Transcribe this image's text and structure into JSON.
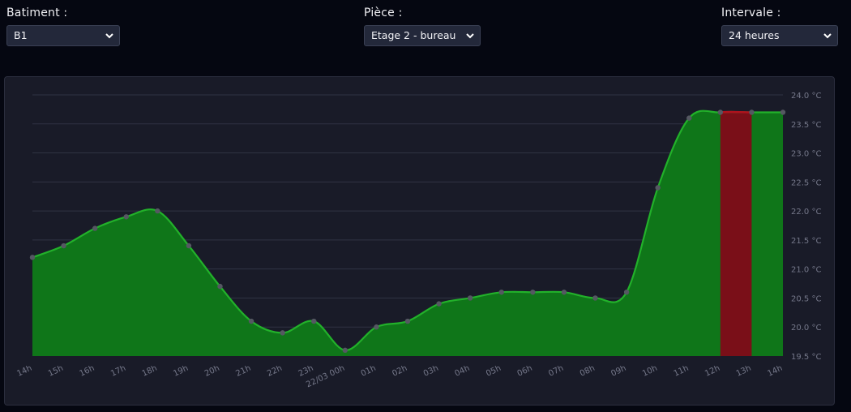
{
  "filters": {
    "batiment": {
      "label": "Batiment :",
      "value": "B1"
    },
    "piece": {
      "label": "Pièce :",
      "value": "Etage 2 - bureau"
    },
    "intervale": {
      "label": "Intervale :",
      "value": "24 heures"
    }
  },
  "chart_data": {
    "type": "area",
    "title": "",
    "xlabel": "",
    "ylabel": "",
    "ylim": [
      19.5,
      24.0
    ],
    "y_ticks": [
      "19.5 °C",
      "20.0 °C",
      "20.5 °C",
      "21.0 °C",
      "21.5 °C",
      "22.0 °C",
      "22.5 °C",
      "23.0 °C",
      "23.5 °C",
      "24.0 °C"
    ],
    "x_ticks": [
      "14h",
      "15h",
      "16h",
      "17h",
      "18h",
      "19h",
      "20h",
      "21h",
      "22h",
      "23h",
      "22/03 00h",
      "01h",
      "02h",
      "03h",
      "04h",
      "05h",
      "06h",
      "07h",
      "08h",
      "09h",
      "10h",
      "11h",
      "12h",
      "13h",
      "14h"
    ],
    "grid": true,
    "x": [
      "14h",
      "15h",
      "16h",
      "17h",
      "18h",
      "19h",
      "20h",
      "21h",
      "22h",
      "23h",
      "22/03 00h",
      "01h",
      "02h",
      "03h",
      "04h",
      "05h",
      "06h",
      "07h",
      "08h",
      "09h",
      "10h",
      "11h",
      "12h",
      "13h",
      "14h"
    ],
    "values": [
      21.2,
      21.4,
      21.7,
      21.9,
      22.0,
      21.4,
      20.7,
      20.1,
      19.9,
      20.1,
      19.6,
      20.0,
      20.1,
      20.4,
      20.5,
      20.6,
      20.6,
      20.6,
      20.5,
      20.6,
      22.4,
      23.6,
      23.7,
      23.7,
      23.7
    ],
    "highlight": {
      "from": "12h",
      "to": "13h",
      "color": "#7a0f18",
      "line_color": "#b0121e"
    },
    "colors": {
      "fill": "#0f7619",
      "line": "#22b12a",
      "point": "#555862",
      "grid": "#303343",
      "axis_text": "#75788a"
    }
  }
}
